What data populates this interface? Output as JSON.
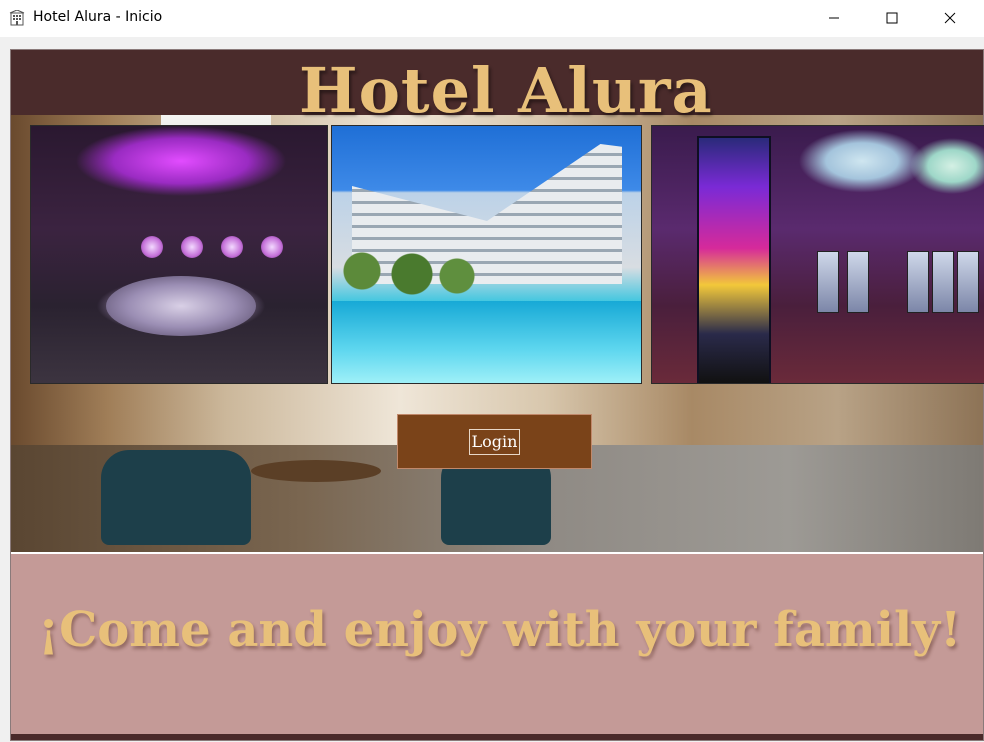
{
  "window": {
    "title": "Hotel Alura - Inicio",
    "icon": "hotel-building-icon",
    "controls": {
      "minimize": "minimize-icon",
      "maximize": "maximize-icon",
      "close": "close-icon"
    }
  },
  "header": {
    "title": "Hotel Alura"
  },
  "gallery": {
    "images": [
      {
        "name": "nightclub-photo",
        "description_icon": "photo-icon"
      },
      {
        "name": "pool-hotel-photo",
        "description_icon": "photo-icon"
      },
      {
        "name": "casino-photo",
        "description_icon": "photo-icon"
      }
    ]
  },
  "actions": {
    "login_label": "Login"
  },
  "footer": {
    "tagline": "¡Come and enjoy with your family!"
  },
  "colors": {
    "header_background": "#4a2b2b",
    "title_gold": "#e8c07a",
    "login_background": "#7a4319",
    "bottom_panel": "#c49a97"
  }
}
